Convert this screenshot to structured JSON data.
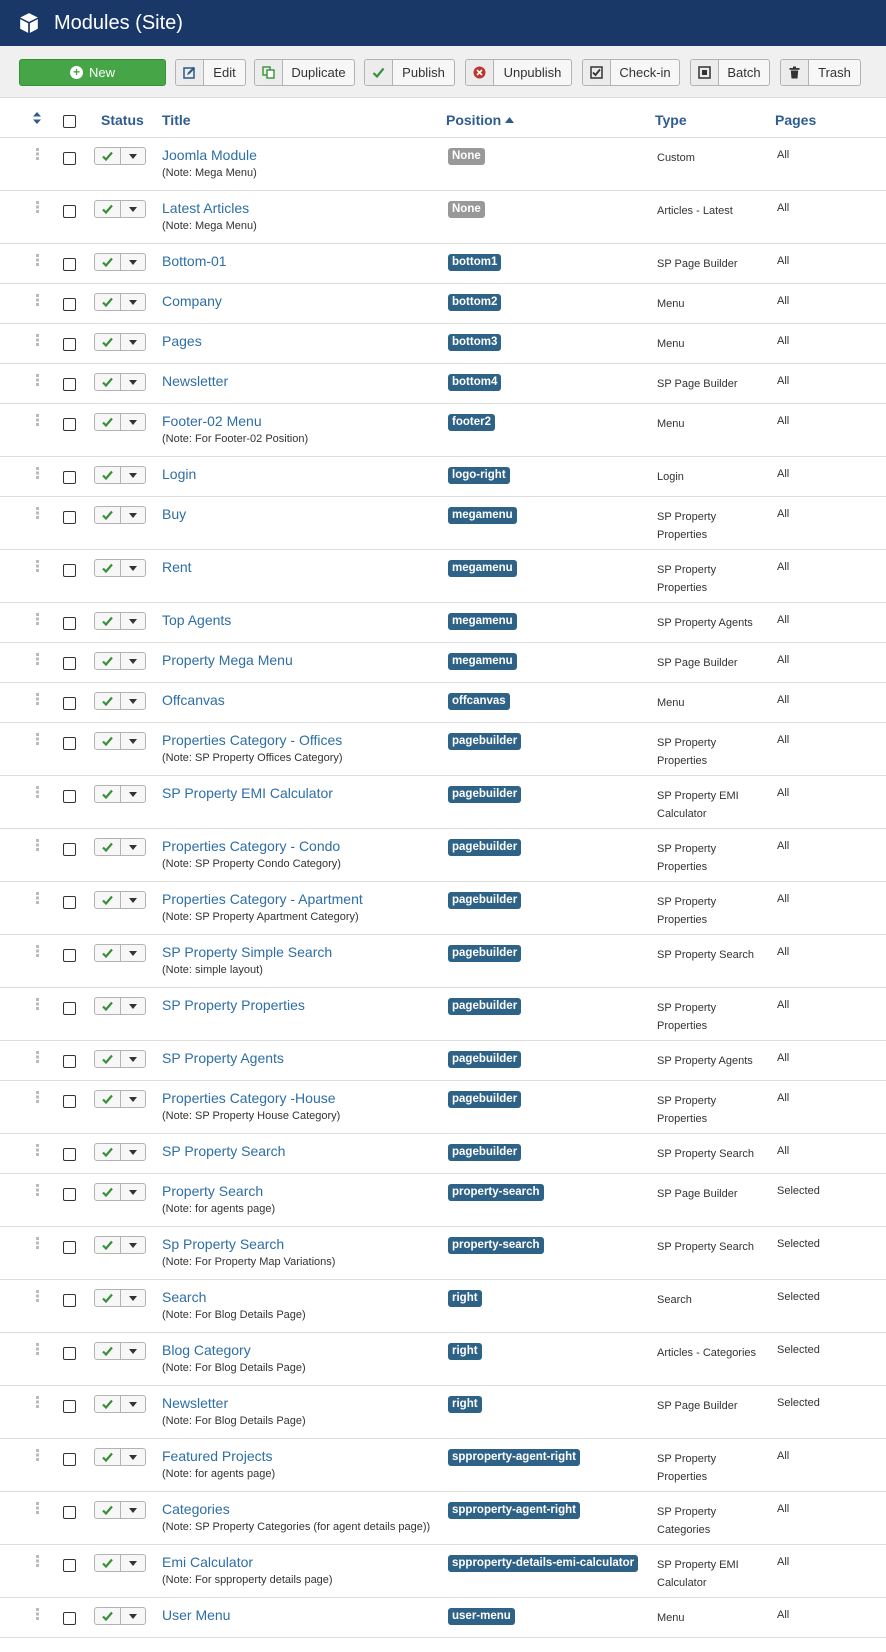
{
  "header": {
    "title": "Modules (Site)"
  },
  "toolbar": {
    "new": "New",
    "edit": "Edit",
    "duplicate": "Duplicate",
    "publish": "Publish",
    "unpublish": "Unpublish",
    "checkin": "Check-in",
    "batch": "Batch",
    "trash": "Trash"
  },
  "columns": {
    "status": "Status",
    "title": "Title",
    "position": "Position",
    "type": "Type",
    "pages": "Pages"
  },
  "colors": {
    "header": "#1a3867",
    "new_button": "#46a546",
    "badge": "#2e6287",
    "badge_none": "#999999",
    "link": "#2d6ea6"
  },
  "rows": [
    {
      "title": "Joomla Module",
      "note": "(Note: Mega Menu)",
      "position": "None",
      "type": "Custom",
      "pages": "All"
    },
    {
      "title": "Latest Articles",
      "note": "(Note: Mega Menu)",
      "position": "None",
      "type": "Articles - Latest",
      "pages": "All"
    },
    {
      "title": "Bottom-01",
      "note": "",
      "position": "bottom1",
      "type": "SP Page Builder",
      "pages": "All"
    },
    {
      "title": "Company",
      "note": "",
      "position": "bottom2",
      "type": "Menu",
      "pages": "All"
    },
    {
      "title": "Pages",
      "note": "",
      "position": "bottom3",
      "type": "Menu",
      "pages": "All"
    },
    {
      "title": "Newsletter",
      "note": "",
      "position": "bottom4",
      "type": "SP Page Builder",
      "pages": "All"
    },
    {
      "title": "Footer-02 Menu",
      "note": "(Note: For Footer-02 Position)",
      "position": "footer2",
      "type": "Menu",
      "pages": "All"
    },
    {
      "title": "Login",
      "note": "",
      "position": "logo-right",
      "type": "Login",
      "pages": "All"
    },
    {
      "title": "Buy",
      "note": "",
      "position": "megamenu",
      "type": "SP Property Properties",
      "pages": "All"
    },
    {
      "title": "Rent",
      "note": "",
      "position": "megamenu",
      "type": "SP Property Properties",
      "pages": "All"
    },
    {
      "title": "Top Agents",
      "note": "",
      "position": "megamenu",
      "type": "SP Property Agents",
      "pages": "All"
    },
    {
      "title": "Property Mega Menu",
      "note": "",
      "position": "megamenu",
      "type": "SP Page Builder",
      "pages": "All"
    },
    {
      "title": "Offcanvas",
      "note": "",
      "position": "offcanvas",
      "type": "Menu",
      "pages": "All"
    },
    {
      "title": "Properties Category - Offices",
      "note": "(Note: SP Property Offices Category)",
      "position": "pagebuilder",
      "type": "SP Property Properties",
      "pages": "All"
    },
    {
      "title": "SP Property EMI Calculator",
      "note": "",
      "position": "pagebuilder",
      "type": "SP Property EMI Calculator",
      "pages": "All"
    },
    {
      "title": "Properties Category - Condo",
      "note": "(Note: SP Property Condo Category)",
      "position": "pagebuilder",
      "type": "SP Property Properties",
      "pages": "All"
    },
    {
      "title": "Properties Category - Apartment",
      "note": "(Note: SP Property Apartment Category)",
      "position": "pagebuilder",
      "type": "SP Property Properties",
      "pages": "All"
    },
    {
      "title": "SP Property Simple Search",
      "note": "(Note: simple layout)",
      "position": "pagebuilder",
      "type": "SP Property Search",
      "pages": "All"
    },
    {
      "title": "SP Property Properties",
      "note": "",
      "position": "pagebuilder",
      "type": "SP Property Properties",
      "pages": "All"
    },
    {
      "title": "SP Property Agents",
      "note": "",
      "position": "pagebuilder",
      "type": "SP Property Agents",
      "pages": "All"
    },
    {
      "title": "Properties Category -House",
      "note": "(Note: SP Property House Category)",
      "position": "pagebuilder",
      "type": "SP Property Properties",
      "pages": "All"
    },
    {
      "title": "SP Property Search",
      "note": "",
      "position": "pagebuilder",
      "type": "SP Property Search",
      "pages": "All"
    },
    {
      "title": "Property Search",
      "note": "(Note: for agents page)",
      "position": "property-search",
      "type": "SP Page Builder",
      "pages": "Selected"
    },
    {
      "title": "Sp Property Search",
      "note": "(Note: For Property Map Variations)",
      "position": "property-search",
      "type": "SP Property Search",
      "pages": "Selected"
    },
    {
      "title": "Search",
      "note": "(Note: For Blog Details Page)",
      "position": "right",
      "type": "Search",
      "pages": "Selected"
    },
    {
      "title": "Blog Category",
      "note": "(Note: For Blog Details Page)",
      "position": "right",
      "type": "Articles - Categories",
      "pages": "Selected"
    },
    {
      "title": "Newsletter",
      "note": "(Note: For Blog Details Page)",
      "position": "right",
      "type": "SP Page Builder",
      "pages": "Selected"
    },
    {
      "title": "Featured Projects",
      "note": "(Note: for agents page)",
      "position": "spproperty-agent-right",
      "type": "SP Property Properties",
      "pages": "All"
    },
    {
      "title": "Categories",
      "note": "(Note: SP Property Categories (for agent details page))",
      "position": "spproperty-agent-right",
      "type": "SP Property Categories",
      "pages": "All"
    },
    {
      "title": "Emi Calculator",
      "note": "(Note: For spproperty details page)",
      "position": "spproperty-details-emi-calculator",
      "type": "SP Property EMI Calculator",
      "pages": "All"
    },
    {
      "title": "User Menu",
      "note": "",
      "position": "user-menu",
      "type": "Menu",
      "pages": "All"
    }
  ]
}
